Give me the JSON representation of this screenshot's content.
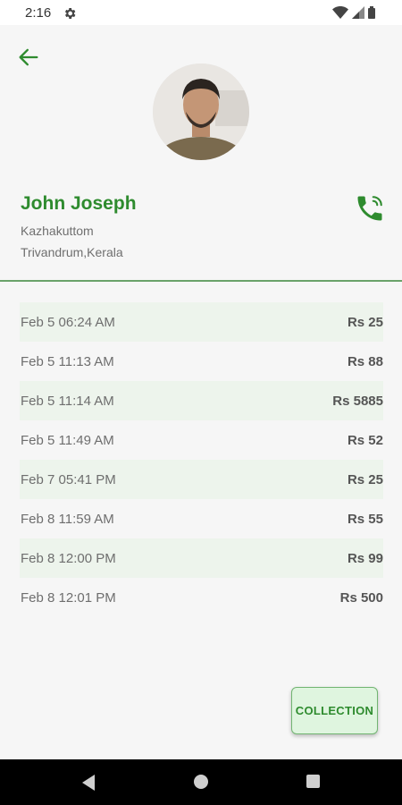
{
  "status_bar": {
    "time": "2:16"
  },
  "icons": {
    "back": "arrow-left-icon",
    "phone": "phone-call-icon",
    "gear": "gear-icon"
  },
  "colors": {
    "accent": "#2e8b2e",
    "row_shade": "#edf4ec",
    "button_bg": "#dff5df"
  },
  "profile": {
    "name": "John Joseph",
    "address_line1": "Kazhakuttom",
    "address_line2": "Trivandrum,Kerala"
  },
  "transactions": [
    {
      "date": "Feb 5 06:24 AM",
      "amount": "Rs 25"
    },
    {
      "date": "Feb 5 11:13 AM",
      "amount": "Rs 88"
    },
    {
      "date": "Feb 5 11:14 AM",
      "amount": "Rs 5885"
    },
    {
      "date": "Feb 5 11:49 AM",
      "amount": "Rs 52"
    },
    {
      "date": "Feb 7 05:41 PM",
      "amount": "Rs 25"
    },
    {
      "date": "Feb 8 11:59 AM",
      "amount": "Rs 55"
    },
    {
      "date": "Feb 8 12:00 PM",
      "amount": "Rs 99"
    },
    {
      "date": "Feb 8 12:01 PM",
      "amount": "Rs 500"
    }
  ],
  "collection_button": {
    "label": "COLLECTION"
  }
}
